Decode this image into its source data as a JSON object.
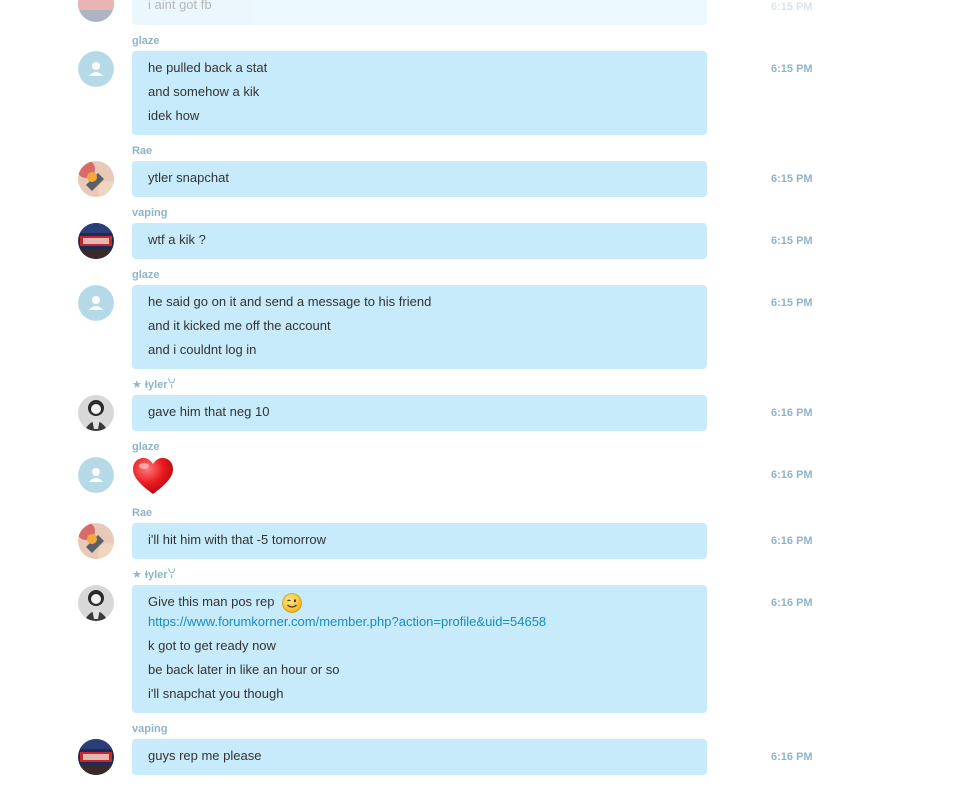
{
  "messages": [
    {
      "sender": "",
      "lines": [
        "i aint got fb"
      ],
      "time": "6:15 PM"
    },
    {
      "sender": "glaze",
      "lines": [
        "he pulled back a stat",
        "and somehow a kik",
        "idek how"
      ],
      "time": "6:15 PM"
    },
    {
      "sender": "Rae",
      "lines": [
        "ytler snapchat"
      ],
      "time": "6:15 PM"
    },
    {
      "sender": "vaping",
      "lines": [
        "wtf a kik ?"
      ],
      "time": "6:15 PM"
    },
    {
      "sender": "glaze",
      "lines": [
        "he said go on it and send a message to his friend",
        "and it kicked me off the account",
        "and i couldnt log in"
      ],
      "time": "6:15 PM"
    },
    {
      "sender": "★ Ɨylerꌩ",
      "lines": [
        "gave him that neg 10"
      ],
      "time": "6:16 PM"
    },
    {
      "sender": "glaze",
      "emoji": "heart",
      "time": "6:16 PM"
    },
    {
      "sender": "Rae",
      "lines": [
        "i'll hit him with that -5 tomorrow"
      ],
      "time": "6:16 PM"
    },
    {
      "sender": "★ Ɨylerꌩ",
      "lines": [
        "Give this man pos rep",
        "https://www.forumkorner.com/member.php?action=profile&uid=54658",
        "k got to get ready now",
        "be back later in like an hour or so",
        "i'll snapchat you though"
      ],
      "inline_emoji": "wink-smile",
      "time": "6:16 PM"
    },
    {
      "sender": "vaping",
      "lines": [
        "guys rep me please"
      ],
      "time": "6:16 PM"
    }
  ],
  "avatars": {
    "glaze": "default-user-icon",
    "Rae": "photo-avatar-rae",
    "vaping": "photo-avatar-vaping",
    "tyler": "photo-avatar-tyler"
  },
  "colors": {
    "bubble": "#c7ebfb",
    "meta_text": "#8fb4c8",
    "link": "#1a8bc4"
  }
}
